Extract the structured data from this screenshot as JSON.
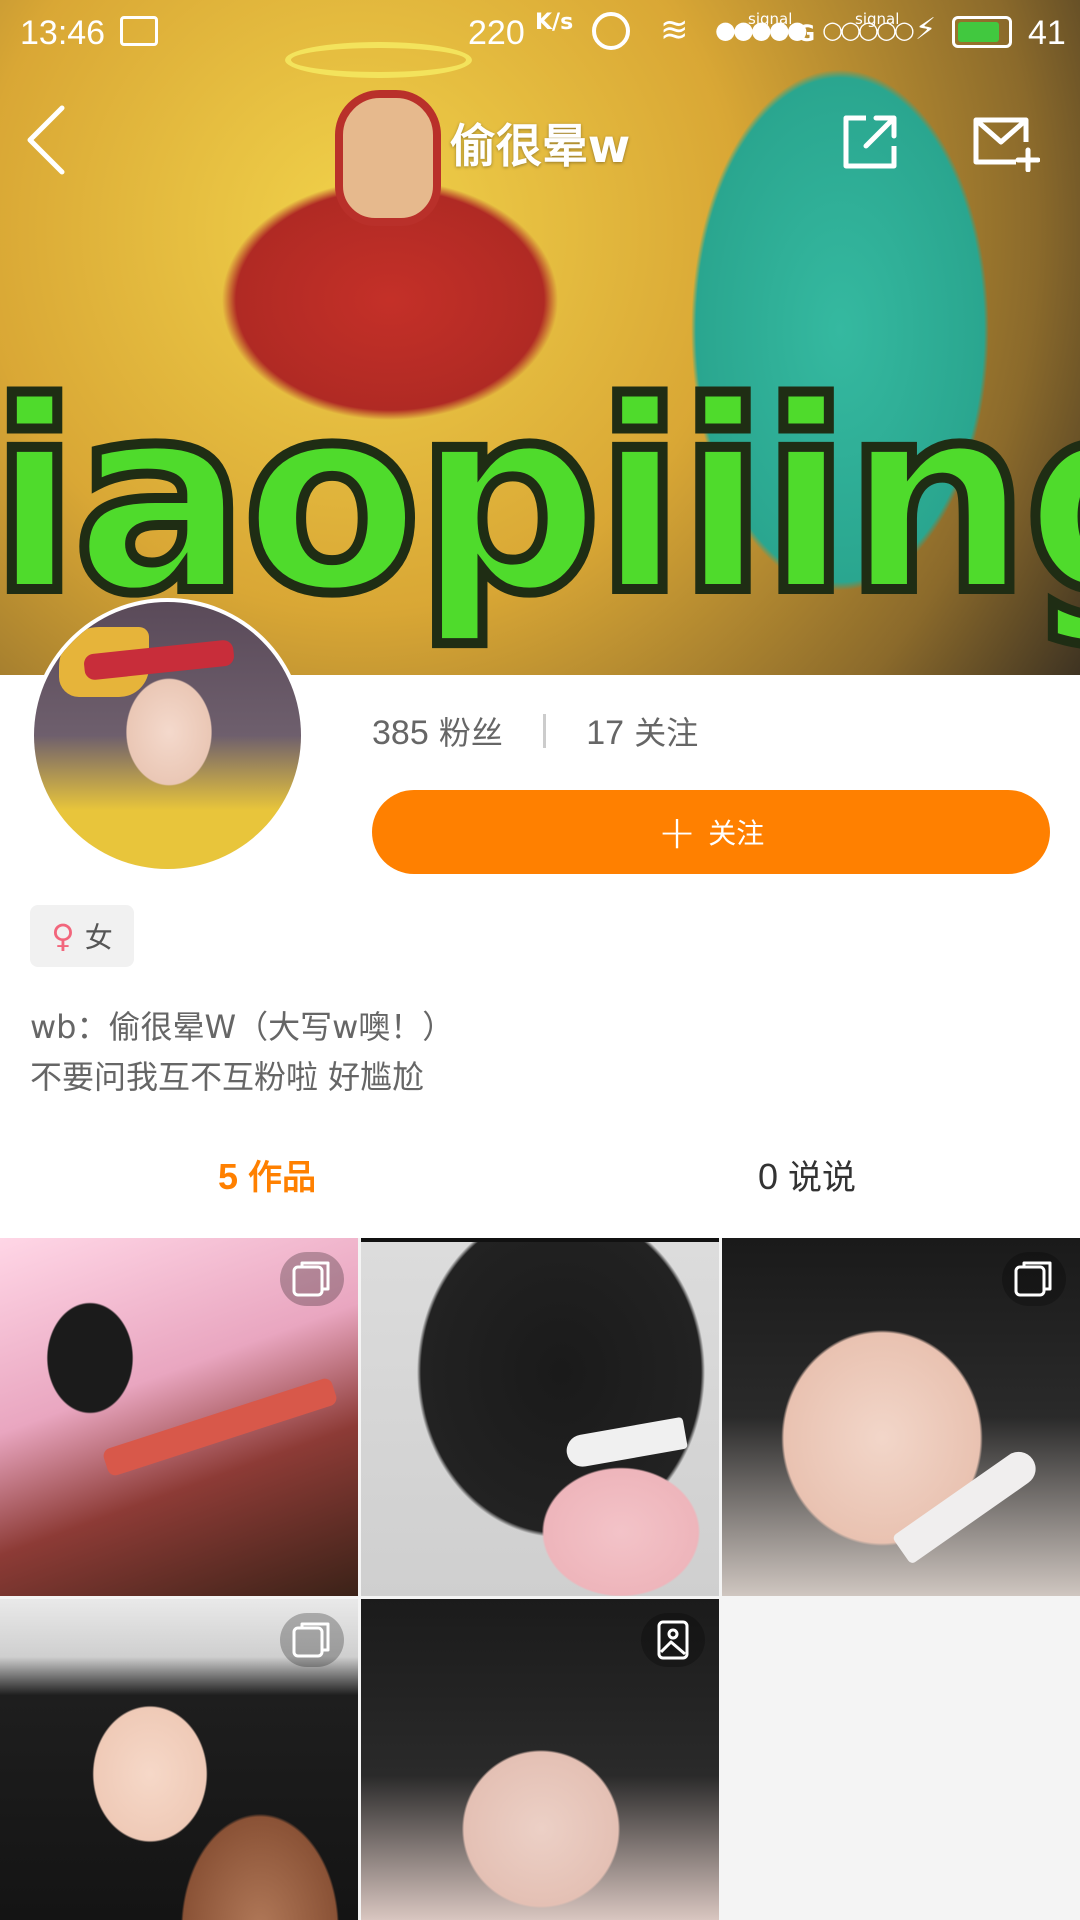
{
  "status_bar": {
    "time": "13:46",
    "net_speed": "220",
    "net_speed_unit": "K/s",
    "signal1_label": "signal",
    "signal1_type": "G",
    "signal2_label": "signal",
    "battery_level": "41",
    "battery_fraction": 0.85,
    "battery_color": "#41c83f"
  },
  "nav": {
    "title": "偷很晕w",
    "back_icon": "chevron-left-icon",
    "share_icon": "share-external-icon",
    "mail_icon": "mail-plus-icon"
  },
  "cover": {
    "text": "iaopiiing"
  },
  "profile": {
    "followers_count": "385",
    "followers_label": "粉丝",
    "following_count": "17",
    "following_label": "关注",
    "follow_button_label": "关注",
    "gender_label": "女",
    "bio_line1": "wb：偷很晕W（大写w噢！）",
    "bio_line2": "不要问我互不互粉啦 好尴尬"
  },
  "tabs": {
    "works_count": "5",
    "works_label": "作品",
    "posts_count": "0",
    "posts_label": "说说"
  },
  "grid": {
    "items": [
      {
        "type": "multi-image-icon"
      },
      {
        "type": "none"
      },
      {
        "type": "multi-image-icon"
      },
      {
        "type": "multi-image-icon"
      },
      {
        "type": "single-image-icon"
      }
    ]
  },
  "colors": {
    "accent": "#ff8000",
    "gender_icon": "#f2667c"
  }
}
